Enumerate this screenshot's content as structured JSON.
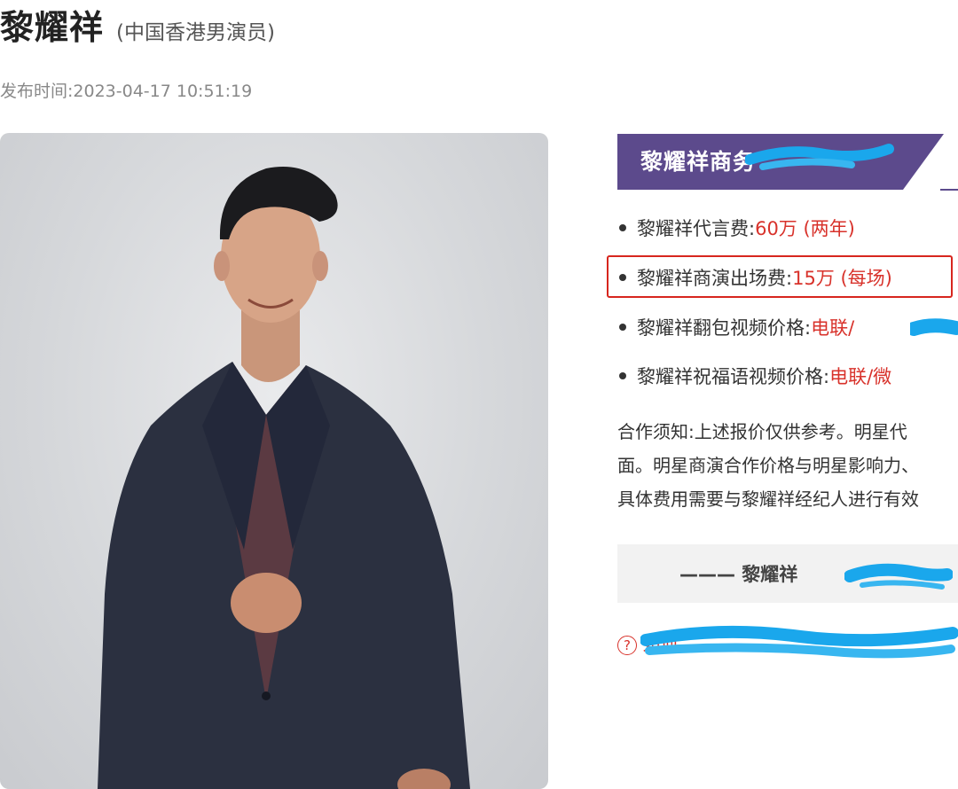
{
  "header": {
    "name": "黎耀祥",
    "subtitle": "(中国香港男演员)",
    "publish_label": "发布时间:",
    "publish_time": "2023-04-17 10:51:19"
  },
  "photo": {
    "description_name": "actor-photo"
  },
  "panel": {
    "banner_title": "黎耀祥商务",
    "banner_color": "#5c4a8c",
    "items": [
      {
        "label": "黎耀祥代言费:",
        "value": "60万 (两年)"
      },
      {
        "label": "黎耀祥商演出场费:",
        "value": "15万 (每场)"
      },
      {
        "label": "黎耀祥翻包视频价格:",
        "value": "电联/"
      },
      {
        "label": "黎耀祥祝福语视频价格:",
        "value": "电联/微"
      }
    ],
    "notice_lines": [
      "合作须知:上述报价仅供参考。明星代",
      "面。明星商演合作价格与明星影响力、",
      "具体费用需要与黎耀祥经纪人进行有效"
    ],
    "section_title": "——— 黎耀祥",
    "help_icon": "?",
    "help_text": "如何"
  },
  "colors": {
    "accent_red": "#d8322b",
    "highlight_border": "#d7261e",
    "scribble_blue": "#1aa7ec"
  }
}
